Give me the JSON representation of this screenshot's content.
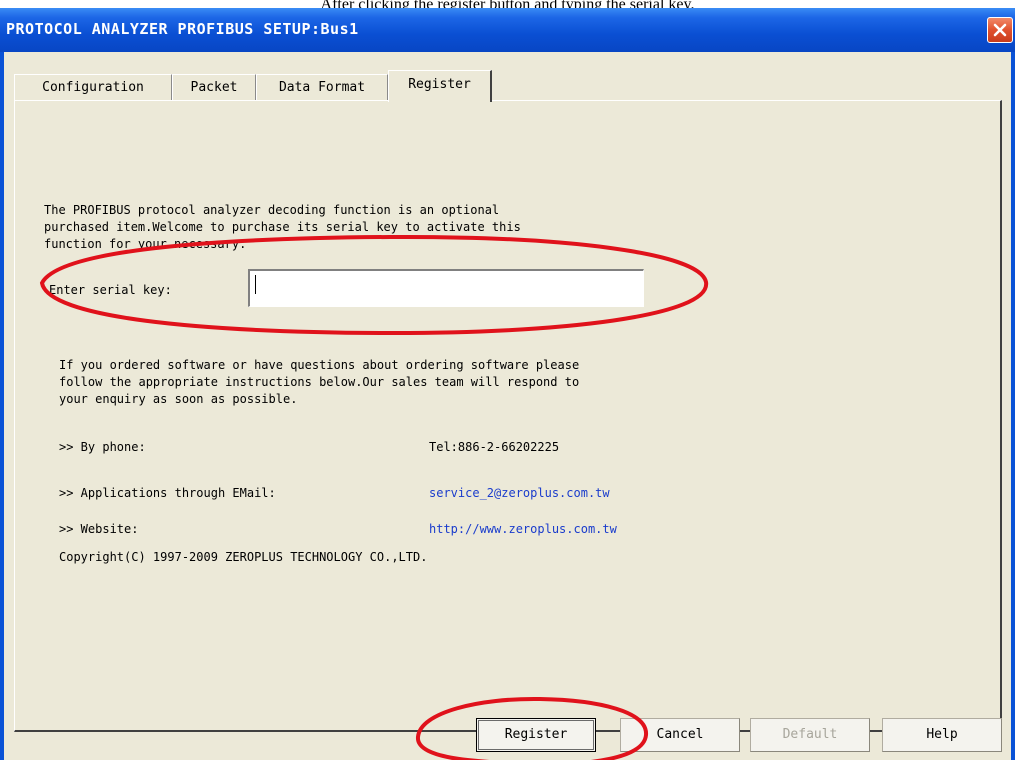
{
  "caption": "After clicking the register button and typing the serial key.",
  "window": {
    "title": "PROTOCOL ANALYZER PROFIBUS SETUP:Bus1"
  },
  "tabs": [
    {
      "label": "Configuration",
      "active": false
    },
    {
      "label": "Packet",
      "active": false
    },
    {
      "label": "Data Format",
      "active": false
    },
    {
      "label": "Register",
      "active": true
    }
  ],
  "register": {
    "intro": "The PROFIBUS protocol analyzer decoding function is an optional\npurchased item.Welcome to purchase its serial key to activate this\nfunction for your necessary.",
    "serial_label": "Enter serial key:",
    "serial_value": "",
    "help_text": "If you ordered software or have questions about ordering software please\nfollow the appropriate instructions below.Our sales team will respond to\nyour enquiry as soon as possible.",
    "contacts": [
      {
        "label": ">> By phone:",
        "value": "Tel:886-2-66202225",
        "link": false
      },
      {
        "label": ">> Applications through EMail:",
        "value": "service_2@zeroplus.com.tw",
        "link": true
      },
      {
        "label": ">> Website:",
        "value": "http://www.zeroplus.com.tw",
        "link": true
      }
    ],
    "copyright": "Copyright(C) 1997-2009 ZEROPLUS TECHNOLOGY CO.,LTD."
  },
  "buttons": {
    "register": "Register",
    "cancel": "Cancel",
    "default": "Default",
    "help": "Help"
  },
  "colors": {
    "title_bar": "#0a4fd3",
    "dialog_bg": "#ece9d8",
    "link": "#1a3ccc",
    "annotation": "#e0121b"
  }
}
